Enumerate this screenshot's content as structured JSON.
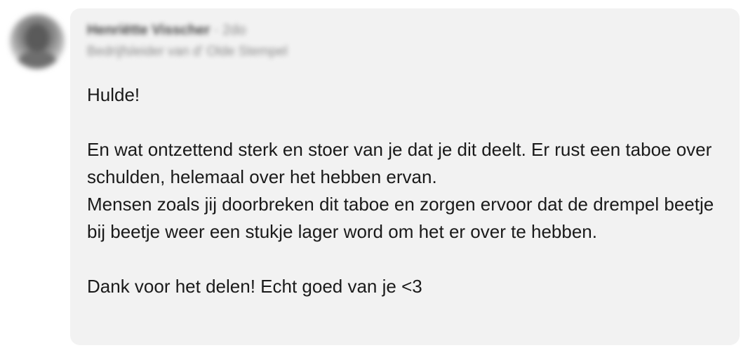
{
  "comment": {
    "author": {
      "name": "Henriëtte Visscher",
      "separator": "·",
      "time": "2do",
      "headline": "Bedrijfsleider van d' Olde Stempel"
    },
    "body": {
      "line_1": "Hulde!",
      "line_2": "En wat ontzettend sterk en stoer van je dat je dit deelt. Er rust een taboe over schulden, helemaal over het hebben ervan.",
      "line_3": "Mensen zoals jij doorbreken dit taboe en zorgen ervoor dat de drempel beetje bij beetje weer een stukje lager word om het er over te hebben.",
      "line_4": "Dank voor het delen! Echt goed van je <3"
    }
  }
}
